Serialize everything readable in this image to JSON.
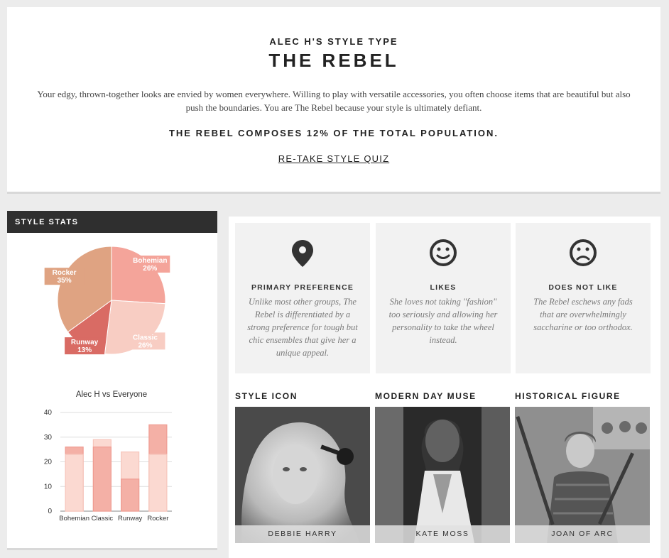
{
  "hero": {
    "eyebrow": "ALEC H'S STYLE TYPE",
    "title": "THE REBEL",
    "description": "Your edgy, thrown-together looks are envied by women everywhere. Willing to play with versatile accessories, you often choose items that are beautiful but also push the boundaries. You are The Rebel because your style is ultimately defiant.",
    "population": "THE REBEL COMPOSES 12% OF THE TOTAL POPULATION.",
    "retake_label": "RE-TAKE STYLE QUIZ"
  },
  "stats": {
    "header": "STYLE STATS",
    "bar_title": "Alec H vs Everyone"
  },
  "chart_data": [
    {
      "type": "pie",
      "labels": [
        "Bohemian",
        "Classic",
        "Runway",
        "Rocker"
      ],
      "values": [
        26,
        26,
        13,
        35
      ],
      "value_labels": [
        "26%",
        "26%",
        "13%",
        "35%"
      ],
      "colors": [
        "#f4a49a",
        "#f8cdc3",
        "#d96b64",
        "#dfa382"
      ]
    },
    {
      "type": "bar",
      "title": "Alec H vs Everyone",
      "categories": [
        "Bohemian",
        "Classic",
        "Runway",
        "Rocker"
      ],
      "series": [
        {
          "values": [
            26,
            26,
            13,
            35
          ],
          "color": "#f4b0a6"
        },
        {
          "values": [
            23,
            29,
            24,
            23
          ],
          "color": "#fbd9d1"
        }
      ],
      "ylim": [
        0,
        40
      ],
      "yticks": [
        0,
        10,
        20,
        30,
        40
      ],
      "grid": true
    }
  ],
  "cards": [
    {
      "title": "PRIMARY PREFERENCE",
      "icon": "map-pin-icon",
      "text": "Unlike most other groups, The Rebel is differentiated by a strong preference for tough but chic ensembles that give her a unique appeal."
    },
    {
      "title": "LIKES",
      "icon": "smiley-face-icon",
      "text": "She loves not taking \"fashion\" too seriously and allowing her personality to take the wheel instead."
    },
    {
      "title": "DOES NOT LIKE",
      "icon": "frowning-face-icon",
      "text": "The Rebel eschews any fads that are overwhelmingly saccharine or too orthodox."
    }
  ],
  "figures": [
    {
      "title": "STYLE ICON",
      "name": "DEBBIE HARRY"
    },
    {
      "title": "MODERN DAY MUSE",
      "name": "KATE MOSS"
    },
    {
      "title": "HISTORICAL FIGURE",
      "name": "JOAN OF ARC"
    }
  ]
}
